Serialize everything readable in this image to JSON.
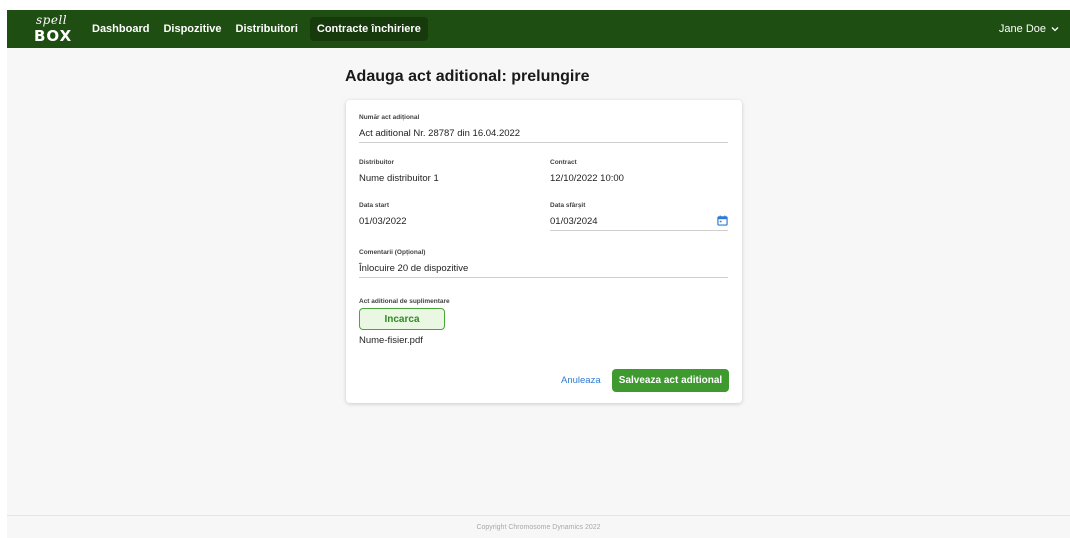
{
  "brand": {
    "logo_top": "spell",
    "logo_bottom": "BOX"
  },
  "nav": {
    "items": [
      {
        "label": "Dashboard"
      },
      {
        "label": "Dispozitive"
      },
      {
        "label": "Distribuitori"
      },
      {
        "label": "Contracte închiriere",
        "active": true
      }
    ],
    "user_name": "Jane Doe"
  },
  "page": {
    "title": "Adauga act aditional: prelungire"
  },
  "form": {
    "numar": {
      "label": "Număr act adițional",
      "value": "Act aditional Nr. 28787 din 16.04.2022"
    },
    "distribuitor": {
      "label": "Distribuitor",
      "value": "Nume distribuitor 1"
    },
    "contract": {
      "label": "Contract",
      "value": "12/10/2022 10:00"
    },
    "data_start": {
      "label": "Data start",
      "value": "01/03/2022"
    },
    "data_sfarsit": {
      "label": "Data sfârșit",
      "value": "01/03/2024"
    },
    "comentarii": {
      "label": "Comentarii (Opțional)",
      "value": "Înlocuire 20 de dispozitive"
    },
    "act_suplimentare": {
      "label": "Act aditional de suplimentare"
    },
    "upload_label": "Incarca",
    "file_name": "Nume-fisier.pdf",
    "cancel_label": "Anuleaza",
    "save_label": "Salveaza act aditional"
  },
  "footer": {
    "copyright": "Copyright Chromosome Dynamics 2022"
  },
  "colors": {
    "navbar": "#1f4e12",
    "primary": "#3e9a2f",
    "link": "#2e7bd6",
    "calendar_icon": "#2e7bd6"
  }
}
